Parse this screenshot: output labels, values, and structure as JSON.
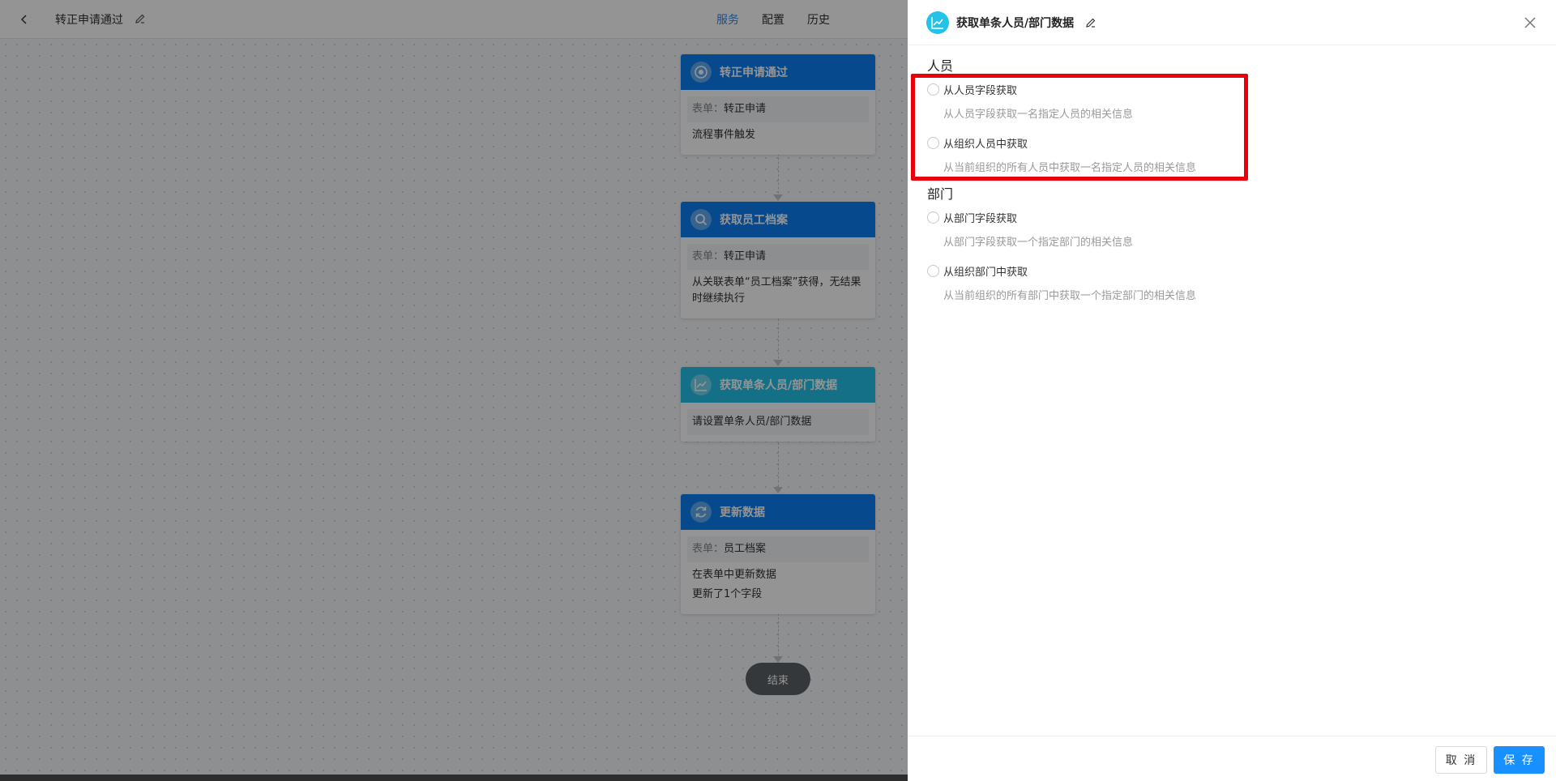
{
  "topbar": {
    "title": "转正申请通过",
    "tabs": [
      {
        "label": "服务",
        "active": true
      },
      {
        "label": "配置",
        "active": false
      },
      {
        "label": "历史",
        "active": false
      }
    ]
  },
  "flow": {
    "nodes": [
      {
        "title": "转正申请通过",
        "icon": "target-icon",
        "color": "#0c7ff2",
        "lines": [
          {
            "key": "表单：",
            "value": "转正申请"
          },
          {
            "key": "",
            "value": "流程事件触发"
          }
        ]
      },
      {
        "title": "获取员工档案",
        "icon": "search-icon",
        "color": "#0c7ff2",
        "lines": [
          {
            "key": "表单：",
            "value": "转正申请"
          },
          {
            "key": "",
            "value": "从关联表单“员工档案”获得，无结果时继续执行"
          }
        ]
      },
      {
        "title": "获取单条人员/部门数据",
        "icon": "chart-line-icon",
        "color": "#24c1e8",
        "lines": [
          {
            "key": "",
            "value": "请设置单条人员/部门数据"
          }
        ]
      },
      {
        "title": "更新数据",
        "icon": "refresh-icon",
        "color": "#0c7ff2",
        "lines": [
          {
            "key": "表单：",
            "value": "员工档案"
          },
          {
            "key": "",
            "value": "在表单中更新数据"
          },
          {
            "key": "",
            "value": "更新了1个字段"
          }
        ]
      }
    ],
    "end_label": "结束"
  },
  "drawer": {
    "title": "获取单条人员/部门数据",
    "accent": "#24c1e8",
    "sections": [
      {
        "title": "人员",
        "options": [
          {
            "label": "从人员字段获取",
            "desc": "从人员字段获取一名指定人员的相关信息"
          },
          {
            "label": "从组织人员中获取",
            "desc": "从当前组织的所有人员中获取一名指定人员的相关信息"
          }
        ]
      },
      {
        "title": "部门",
        "options": [
          {
            "label": "从部门字段获取",
            "desc": "从部门字段获取一个指定部门的相关信息"
          },
          {
            "label": "从组织部门中获取",
            "desc": "从当前组织的所有部门中获取一个指定部门的相关信息"
          }
        ]
      }
    ],
    "footer": {
      "cancel_label": "取 消",
      "save_label": "保 存"
    }
  },
  "colors": {
    "primary": "#1890ff",
    "highlight": "#e8000b",
    "node_blue": "#0c7ff2",
    "node_cyan": "#24c1e8"
  }
}
